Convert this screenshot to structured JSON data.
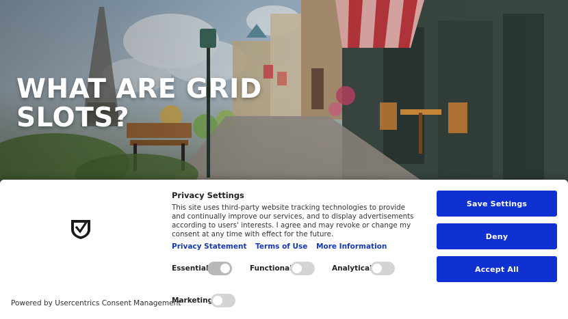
{
  "hero": {
    "title_line1": "WHAT ARE GRID",
    "title_line2": "SLOTS?"
  },
  "consent": {
    "heading": "Privacy Settings",
    "description": "This site uses third-party website tracking technologies to provide and continually improve our services, and to display advertisements according to users' interests. I agree and may revoke or change my consent at any time with effect for the future.",
    "links": {
      "privacy_statement": "Privacy Statement",
      "terms_of_use": "Terms of Use",
      "more_information": "More Information"
    },
    "toggles": [
      {
        "label": "Essential",
        "enabled": true,
        "locked": true
      },
      {
        "label": "Functional",
        "enabled": false,
        "locked": false
      },
      {
        "label": "Analytical",
        "enabled": false,
        "locked": false
      },
      {
        "label": "Marketing",
        "enabled": false,
        "locked": false
      }
    ],
    "buttons": {
      "save_settings": "Save Settings",
      "deny": "Deny",
      "accept_all": "Accept All"
    },
    "powered_by": "Powered by Usercentrics Consent Management",
    "logo_icon": "shield-check-icon",
    "colors": {
      "accent": "#1031d1",
      "link": "#1437b6"
    }
  }
}
